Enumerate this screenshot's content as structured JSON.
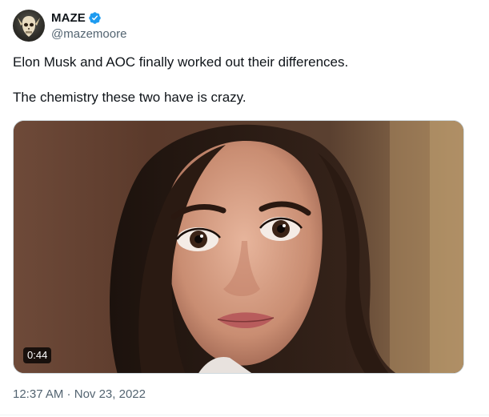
{
  "author": {
    "display_name": "MAZE",
    "handle": "@mazemoore",
    "verified_icon": "verified-badge-icon",
    "badge_color": "#1d9bf0",
    "avatar_icon": "skull-avatar-icon"
  },
  "tweet": {
    "paragraphs": [
      "Elon Musk and AOC finally worked out their differences.",
      "The chemistry these two have is crazy."
    ]
  },
  "media": {
    "type": "video",
    "duration": "0:44"
  },
  "meta": {
    "time": "12:37 AM",
    "separator": " · ",
    "date": "Nov 23, 2022"
  }
}
